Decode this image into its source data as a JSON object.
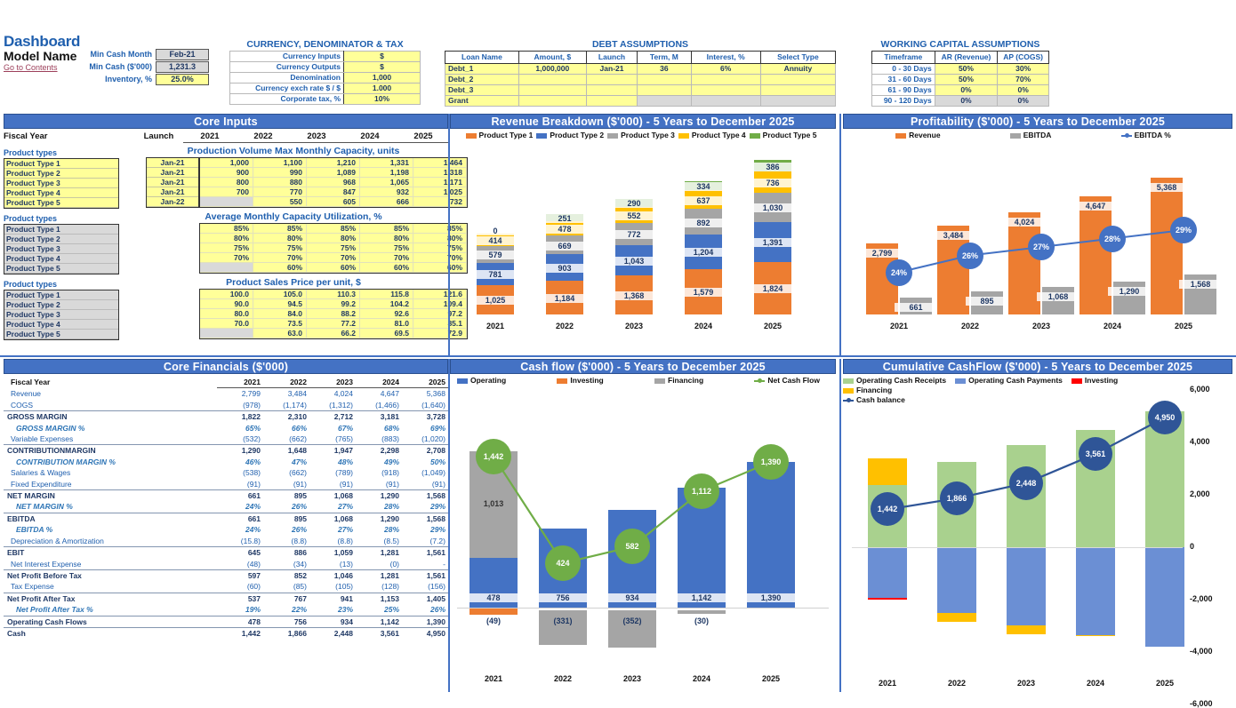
{
  "header": {
    "dashboard_title": "Dashboard",
    "model_name": "Model Name",
    "contents_link": "Go to Contents",
    "min_cash_month_label": "Min Cash Month",
    "min_cash_month_value": "Feb-21",
    "min_cash_label": "Min Cash ($'000)",
    "min_cash_value": "1,231.3",
    "inventory_label": "Inventory, %",
    "inventory_value": "25.0%"
  },
  "currency": {
    "title": "CURRENCY, DENOMINATOR & TAX",
    "rows": [
      {
        "label": "Currency Inputs",
        "value": "$"
      },
      {
        "label": "Currency Outputs",
        "value": "$"
      },
      {
        "label": "Denomination",
        "value": "1,000"
      },
      {
        "label": "Currency exch rate $ / $",
        "value": "1.000"
      },
      {
        "label": "Corporate tax, %",
        "value": "10%"
      }
    ]
  },
  "debt": {
    "title": "DEBT ASSUMPTIONS",
    "columns": [
      "Loan Name",
      "Amount, $",
      "Launch",
      "Term, M",
      "Interest, %",
      "Select Type"
    ],
    "rows": [
      {
        "name": "Debt_1",
        "amount": "1,000,000",
        "launch": "Jan-21",
        "term": "36",
        "interest": "6%",
        "type": "Annuity",
        "disabled": false
      },
      {
        "name": "Debt_2",
        "amount": "",
        "launch": "",
        "term": "",
        "interest": "",
        "type": "",
        "disabled": false
      },
      {
        "name": "Debt_3",
        "amount": "",
        "launch": "",
        "term": "",
        "interest": "",
        "type": "",
        "disabled": false
      },
      {
        "name": "Grant",
        "amount": "",
        "launch": "",
        "term": "",
        "interest": "",
        "type": "",
        "disabled": true
      }
    ]
  },
  "working_capital": {
    "title": "WORKING CAPITAL ASSUMPTIONS",
    "columns": [
      "Timeframe",
      "AR (Revenue)",
      "AP (COGS)"
    ],
    "rows": [
      {
        "timeframe": "0 - 30 Days",
        "ar": "50%",
        "ap": "30%",
        "disabled": false
      },
      {
        "timeframe": "31 - 60 Days",
        "ar": "50%",
        "ap": "70%",
        "disabled": false
      },
      {
        "timeframe": "61 - 90 Days",
        "ar": "0%",
        "ap": "0%",
        "disabled": false
      },
      {
        "timeframe": "90 - 120 Days",
        "ar": "0%",
        "ap": "0%",
        "disabled": true
      }
    ]
  },
  "core_inputs": {
    "band_title": "Core Inputs",
    "fiscal_year_label": "Fiscal Year",
    "launch_label": "Launch",
    "years": [
      "2021",
      "2022",
      "2023",
      "2024",
      "2025"
    ],
    "product_types_label": "Product types",
    "product_names": [
      "Product Type 1",
      "Product Type 2",
      "Product Type 3",
      "Product Type 4",
      "Product Type 5"
    ],
    "launches": [
      "Jan-21",
      "Jan-21",
      "Jan-21",
      "Jan-21",
      "Jan-22"
    ],
    "capacity": {
      "title": "Production Volume Max Monthly Capacity, units",
      "rows": [
        [
          "1,000",
          "1,100",
          "1,210",
          "1,331",
          "1,464"
        ],
        [
          "900",
          "990",
          "1,089",
          "1,198",
          "1,318"
        ],
        [
          "800",
          "880",
          "968",
          "1,065",
          "1,171"
        ],
        [
          "700",
          "770",
          "847",
          "932",
          "1,025"
        ],
        [
          "",
          "550",
          "605",
          "666",
          "732"
        ]
      ]
    },
    "utilization": {
      "title": "Average Monthly Capacity Utilization, %",
      "rows": [
        [
          "85%",
          "85%",
          "85%",
          "85%",
          "85%"
        ],
        [
          "80%",
          "80%",
          "80%",
          "80%",
          "80%"
        ],
        [
          "75%",
          "75%",
          "75%",
          "75%",
          "75%"
        ],
        [
          "70%",
          "70%",
          "70%",
          "70%",
          "70%"
        ],
        [
          "",
          "60%",
          "60%",
          "60%",
          "60%"
        ]
      ]
    },
    "price": {
      "title": "Product Sales Price per unit, $",
      "rows": [
        [
          "100.0",
          "105.0",
          "110.3",
          "115.8",
          "121.6"
        ],
        [
          "90.0",
          "94.5",
          "99.2",
          "104.2",
          "109.4"
        ],
        [
          "80.0",
          "84.0",
          "88.2",
          "92.6",
          "97.2"
        ],
        [
          "70.0",
          "73.5",
          "77.2",
          "81.0",
          "85.1"
        ],
        [
          "",
          "63.0",
          "66.2",
          "69.5",
          "72.9"
        ]
      ]
    }
  },
  "core_financials": {
    "band_title": "Core Financials ($'000)",
    "fiscal_year_label": "Fiscal Year",
    "years": [
      "2021",
      "2022",
      "2023",
      "2024",
      "2025"
    ],
    "rows": [
      {
        "label": "Revenue",
        "style": "normal",
        "values": [
          "2,799",
          "3,484",
          "4,024",
          "4,647",
          "5,368"
        ]
      },
      {
        "label": "COGS",
        "style": "normal",
        "values": [
          "(978)",
          "(1,174)",
          "(1,312)",
          "(1,466)",
          "(1,640)"
        ]
      },
      {
        "label": "GROSS MARGIN",
        "style": "bold-rule",
        "values": [
          "1,822",
          "2,310",
          "2,712",
          "3,181",
          "3,728"
        ]
      },
      {
        "label": "GROSS MARGIN %",
        "style": "italic",
        "values": [
          "65%",
          "66%",
          "67%",
          "68%",
          "69%"
        ]
      },
      {
        "label": "Variable Expenses",
        "style": "normal",
        "values": [
          "(532)",
          "(662)",
          "(765)",
          "(883)",
          "(1,020)"
        ]
      },
      {
        "label": "CONTRIBUTIONMARGIN",
        "style": "bold-rule",
        "values": [
          "1,290",
          "1,648",
          "1,947",
          "2,298",
          "2,708"
        ]
      },
      {
        "label": "CONTRIBUTION MARGIN %",
        "style": "italic",
        "values": [
          "46%",
          "47%",
          "48%",
          "49%",
          "50%"
        ]
      },
      {
        "label": "Salaries & Wages",
        "style": "normal",
        "values": [
          "(538)",
          "(662)",
          "(789)",
          "(918)",
          "(1,049)"
        ]
      },
      {
        "label": "Fixed Expenditure",
        "style": "normal",
        "values": [
          "(91)",
          "(91)",
          "(91)",
          "(91)",
          "(91)"
        ]
      },
      {
        "label": "NET MARGIN",
        "style": "bold-rule",
        "values": [
          "661",
          "895",
          "1,068",
          "1,290",
          "1,568"
        ]
      },
      {
        "label": "NET MARGIN %",
        "style": "italic",
        "values": [
          "24%",
          "26%",
          "27%",
          "28%",
          "29%"
        ]
      },
      {
        "label": "EBITDA",
        "style": "bold-rule",
        "values": [
          "661",
          "895",
          "1,068",
          "1,290",
          "1,568"
        ]
      },
      {
        "label": "EBITDA %",
        "style": "italic",
        "values": [
          "24%",
          "26%",
          "27%",
          "28%",
          "29%"
        ]
      },
      {
        "label": "Depreciation & Amortization",
        "style": "normal",
        "values": [
          "(15.8)",
          "(8.8)",
          "(8.8)",
          "(8.5)",
          "(7.2)"
        ]
      },
      {
        "label": "EBIT",
        "style": "bold-rule",
        "values": [
          "645",
          "886",
          "1,059",
          "1,281",
          "1,561"
        ]
      },
      {
        "label": "Net Interest Expense",
        "style": "normal",
        "values": [
          "(48)",
          "(34)",
          "(13)",
          "(0)",
          "-"
        ]
      },
      {
        "label": "Net Profit Before Tax",
        "style": "bold-rule",
        "values": [
          "597",
          "852",
          "1,046",
          "1,281",
          "1,561"
        ]
      },
      {
        "label": "Tax Expense",
        "style": "normal",
        "values": [
          "(60)",
          "(85)",
          "(105)",
          "(128)",
          "(156)"
        ]
      },
      {
        "label": "Net Profit After Tax",
        "style": "bold-rule",
        "values": [
          "537",
          "767",
          "941",
          "1,153",
          "1,405"
        ]
      },
      {
        "label": "Net Profit After Tax %",
        "style": "italic",
        "values": [
          "19%",
          "22%",
          "23%",
          "25%",
          "26%"
        ]
      },
      {
        "label": "Operating Cash Flows",
        "style": "bold-rule",
        "values": [
          "478",
          "756",
          "934",
          "1,142",
          "1,390"
        ]
      },
      {
        "label": "Cash",
        "style": "bold-rule",
        "values": [
          "1,442",
          "1,866",
          "2,448",
          "3,561",
          "4,950"
        ]
      }
    ]
  },
  "chart_data": [
    {
      "id": "revenue_breakdown",
      "type": "bar",
      "stacked": true,
      "title": "Revenue Breakdown ($'000) - 5 Years to December 2025",
      "categories": [
        "2021",
        "2022",
        "2023",
        "2024",
        "2025"
      ],
      "legend_position": "top",
      "series": [
        {
          "name": "Product Type 1",
          "color": "#ED7D31",
          "values": [
            1025,
            1184,
            1368,
            1579,
            1824
          ]
        },
        {
          "name": "Product Type 2",
          "color": "#4472C4",
          "values": [
            781,
            903,
            1043,
            1204,
            1391
          ]
        },
        {
          "name": "Product Type 3",
          "color": "#A5A5A5",
          "values": [
            579,
            669,
            772,
            892,
            1030
          ]
        },
        {
          "name": "Product Type 4",
          "color": "#FFC000",
          "values": [
            414,
            478,
            552,
            637,
            736
          ]
        },
        {
          "name": "Product Type 5",
          "color": "#70AD47",
          "values": [
            0,
            251,
            290,
            334,
            386
          ]
        }
      ],
      "ylim": [
        0,
        5368
      ],
      "grid": false
    },
    {
      "id": "profitability",
      "type": "bar",
      "title": "Profitability ($'000) - 5 Years to December 2025",
      "categories": [
        "2021",
        "2022",
        "2023",
        "2024",
        "2025"
      ],
      "legend_position": "top",
      "series": [
        {
          "name": "Revenue",
          "color": "#ED7D31",
          "values": [
            2799,
            3484,
            4024,
            4647,
            5368
          ]
        },
        {
          "name": "EBITDA",
          "color": "#A5A5A5",
          "values": [
            661,
            895,
            1068,
            1290,
            1568
          ]
        },
        {
          "name": "EBITDA %",
          "color": "#4472C4",
          "type": "line",
          "values": [
            "24%",
            "26%",
            "27%",
            "28%",
            "29%"
          ],
          "numeric": [
            24,
            26,
            27,
            28,
            29
          ]
        }
      ],
      "ylim": [
        0,
        5800
      ],
      "grid": false
    },
    {
      "id": "cash_flow",
      "type": "bar",
      "stacked": true,
      "title": "Cash flow ($'000) - 5 Years to December 2025",
      "categories": [
        "2021",
        "2022",
        "2023",
        "2024",
        "2025"
      ],
      "legend_position": "top",
      "series": [
        {
          "name": "Operating",
          "color": "#4472C4",
          "values": [
            478,
            756,
            934,
            1142,
            1390
          ]
        },
        {
          "name": "Investing",
          "color": "#ED7D31",
          "values": [
            -49,
            0,
            0,
            0,
            0
          ]
        },
        {
          "name": "Financing",
          "color": "#A5A5A5",
          "values": [
            1013,
            -331,
            -352,
            -30,
            0
          ]
        },
        {
          "name": "Net Cash Flow",
          "color": "#70AD47",
          "type": "line",
          "values": [
            1442,
            424,
            582,
            1112,
            1390
          ]
        }
      ],
      "negative_labels": [
        "(49)",
        "(331)",
        "(352)",
        "(30)",
        ""
      ],
      "ylim": [
        -900,
        1600
      ],
      "grid": false
    },
    {
      "id": "cumulative_cashflow",
      "type": "bar",
      "stacked": true,
      "title": "Cumulative CashFlow ($'000) - 5 Years to December 2025",
      "categories": [
        "2021",
        "2022",
        "2023",
        "2024",
        "2025"
      ],
      "legend_position": "top",
      "ytick_labels": [
        "6,000",
        "4,000",
        "2,000",
        "0",
        "-2,000",
        "-4,000",
        "-6,000"
      ],
      "ylim": [
        -6000,
        6000
      ],
      "series": [
        {
          "name": "Operating Cash Receipts",
          "color": "#A9D18E",
          "values": [
            2387,
            3263,
            3905,
            4486,
            5173
          ]
        },
        {
          "name": "Operating Cash Payments",
          "color": "#6B8FD4",
          "values": [
            -1930,
            -2507,
            -2971,
            -3344,
            -3783
          ]
        },
        {
          "name": "Investing",
          "color": "#FF0000",
          "values": [
            -49,
            0,
            0,
            0,
            0
          ]
        },
        {
          "name": "Financing",
          "color": "#FFC000",
          "values": [
            1013,
            -331,
            -352,
            -30,
            0
          ]
        },
        {
          "name": "Cash balance",
          "color": "#2F5597",
          "type": "line",
          "values": [
            1442,
            1866,
            2448,
            3561,
            4950
          ]
        }
      ],
      "grid": false
    }
  ]
}
